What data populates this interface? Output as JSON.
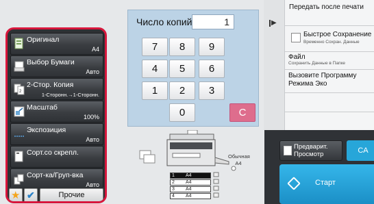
{
  "copies": {
    "label": "Число копий",
    "value": "1"
  },
  "keypad": {
    "keys": [
      "7",
      "8",
      "9",
      "4",
      "5",
      "6",
      "1",
      "2",
      "3",
      "0"
    ],
    "clear": "C"
  },
  "menu": {
    "items": [
      {
        "label": "Оригинал",
        "value": "A4",
        "icon": "original-icon"
      },
      {
        "label": "Выбор Бумаги",
        "value": "Авто",
        "icon": "paper-icon"
      },
      {
        "label": "2-Стор. Копия",
        "value": "1-Сторонн.→1-Сторонн.",
        "icon": "duplex-icon"
      },
      {
        "label": "Масштаб",
        "value": "100%",
        "icon": "scale-icon"
      },
      {
        "label": "Экспозиция",
        "value": "Авто",
        "icon": "exposure-icon"
      },
      {
        "label": "Сорт.со скрепл.",
        "value": "",
        "icon": "staple-sort-icon"
      },
      {
        "label": "Сорт-ка/Груп-вка",
        "value": "Авто",
        "icon": "sort-group-icon"
      }
    ],
    "others_label": "Прочие"
  },
  "machine": {
    "output_label": "Обычная",
    "output_size": "A4",
    "trays": [
      {
        "num": "1",
        "size": "A4"
      },
      {
        "num": "2",
        "size": "A4"
      },
      {
        "num": "3",
        "size": "A4"
      },
      {
        "num": "4",
        "size": "A4"
      }
    ]
  },
  "right_panel": {
    "items": [
      {
        "title": "Передать после печати",
        "sub": ""
      },
      {
        "title": "Быстрое Сохранение",
        "sub": "Временно Сохран. Данные"
      },
      {
        "title": "Файл",
        "sub": "Сохранить Данные в Папке"
      },
      {
        "title": "Вызовите Программу Режима Эко",
        "sub": ""
      }
    ]
  },
  "buttons": {
    "preview": "Предварит. Просмотр",
    "ca": "CA",
    "start": "Старт"
  },
  "colors": {
    "accent_red": "#d8163c",
    "keypad_bg": "#bcd3e6",
    "start_blue": "#27a6d9",
    "clear_pink": "#de6d8d",
    "star_orange": "#f4a51d"
  }
}
